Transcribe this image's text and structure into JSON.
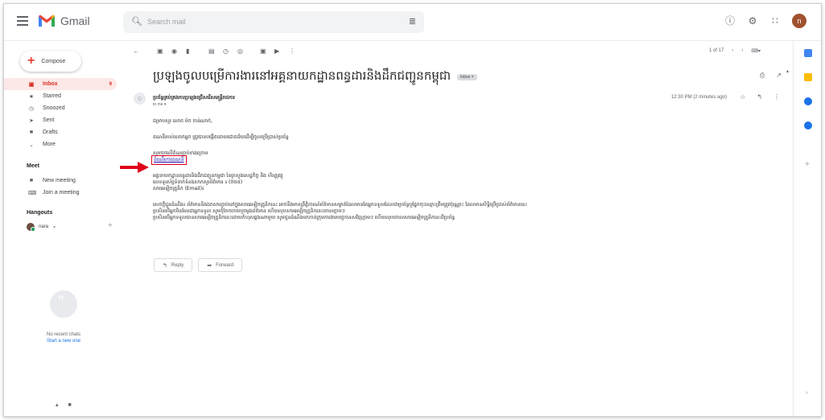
{
  "header": {
    "app_name": "Gmail",
    "search_placeholder": "Search mail",
    "avatar_letter": "n"
  },
  "sidebar": {
    "compose_label": "Compose",
    "items": [
      {
        "label": "Inbox",
        "count": "9",
        "icon": "inbox-icon",
        "active": true
      },
      {
        "label": "Starred",
        "icon": "star-icon"
      },
      {
        "label": "Snoozed",
        "icon": "clock-icon"
      },
      {
        "label": "Sent",
        "icon": "send-icon"
      },
      {
        "label": "Drafts",
        "icon": "draft-icon"
      },
      {
        "label": "More",
        "icon": "chevron-down-icon"
      }
    ],
    "meet_title": "Meet",
    "meet_items": [
      {
        "label": "New meeting",
        "icon": "video-icon"
      },
      {
        "label": "Join a meeting",
        "icon": "keyboard-icon"
      }
    ],
    "hangouts_title": "Hangouts",
    "hangouts_user": "nara",
    "no_chats": "No recent chats",
    "start_new": "Start a new one"
  },
  "toolbar": {
    "pager": "1 of 17"
  },
  "email": {
    "subject": "ប្រឡងចូលបម្រើការងារនៅអគ្គនាយកដ្ឋានពន្ធដារនិងដឹកជញ្ជូនកម្ពុជា",
    "label": "Inbox ×",
    "sender": "ប្រព័ន្ធគ្រប់គ្រងការប្រឡងជ្រើសរើសមន្ត្រីរាជការ",
    "to": "to me ▾",
    "time": "12:30 PM (2 minutes ago)",
    "body": {
      "greeting": "ជម្រាបសួរ លោក ម៉ក ចាន់ណាក់,",
      "p1": "គណនីរបស់លោកអ្នក ត្រូវបានបង្កើតដោយជោគជ័យដើម្បីចូលប្រើប្រាស់ប្រព័ន្ធ",
      "p2_line": "សូមចុចលើតំណភ្ជាប់ខាងក្រោម",
      "link": "ដំណើរការគណនី",
      "sig1": "អគ្គនាយកដ្ឋានពន្ធដារនិងដឹកជញ្ជូនកម្ពុជា នៃក្រសួងសេដ្ឋកិច្ច និង ហិរញ្ញវត្ថុ",
      "sig2": "លេខទូរស័ព្ទទំនាក់ទំនងសាកសួរព័ត៌មាន ៖ (0៥៥)",
      "sig3": "សារអេឡិចត្រូនិក (Email)៖",
      "note1": "សេចក្តីជូនដំណឹង៖ ព័ត៌មាននិងឯកសារភ្ជាប់នៅក្នុងសារអេឡិចត្រូនិកនេះ អាចនឹងមានព្រឹត្តិការណ៍ព័ត៌មានសម្ងាត់ដែលមានតែអ្នកទទួលដែលជាប្រព័ន្ធឬផ្នែកចុះឈ្មោះត្រឹមត្រូវប៉ុណ្ណោះ ដែលមានសិទ្ធិប្រើប្រាស់ព័ត៌មាននេះ",
      "note2": "ប្រសិនបើអ្នកមិនមែនជាអ្នកទទួល សូមកុំចែកចាយឬចម្លងព័ត៌មាន ហើយលុបសារអេឡិចត្រូនិកនេះចោលភ្លាមៗ",
      "note3": "ប្រសិនបើអ្នកទទួលបានសារអេឡិចត្រូនិកនេះដោយកំហុសឆ្គងណាមួយ សូមជូនដំណឹងមកកាន់ក្រុមការងារបច្ចេកទេសវិញភ្លាមៗ ហើយលុបចោលសារអេឡិចត្រូនិកនេះពីប្រព័ន្ធ"
    },
    "reply_label": "Reply",
    "forward_label": "Forward"
  },
  "colors": {
    "accent_red": "#d93025",
    "link_blue": "#1a0dab",
    "highlight_red": "#e0001a"
  }
}
